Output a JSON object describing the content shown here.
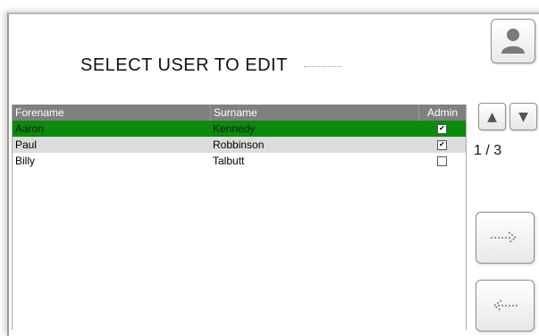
{
  "title": "SELECT USER TO EDIT",
  "table": {
    "headers": [
      "Forename",
      "Surname",
      "Admin"
    ],
    "rows": [
      {
        "forename": "Aaron",
        "surname": "Kennedy",
        "admin": true,
        "selected": true
      },
      {
        "forename": "Paul",
        "surname": "Robbinson",
        "admin": true,
        "selected": false
      },
      {
        "forename": "Billy",
        "surname": "Talbutt",
        "admin": false,
        "selected": false
      }
    ]
  },
  "pagination": {
    "label": "1 / 3"
  },
  "icons": {
    "user": "user-icon",
    "up": "arrow-up-icon",
    "down": "arrow-down-icon",
    "forward": "dotted-arrow-right-icon",
    "back": "dotted-arrow-left-icon"
  },
  "colors": {
    "selected_row": "#0b8a0b",
    "header_bg": "#808080",
    "alt_row": "#dcdcdc"
  }
}
